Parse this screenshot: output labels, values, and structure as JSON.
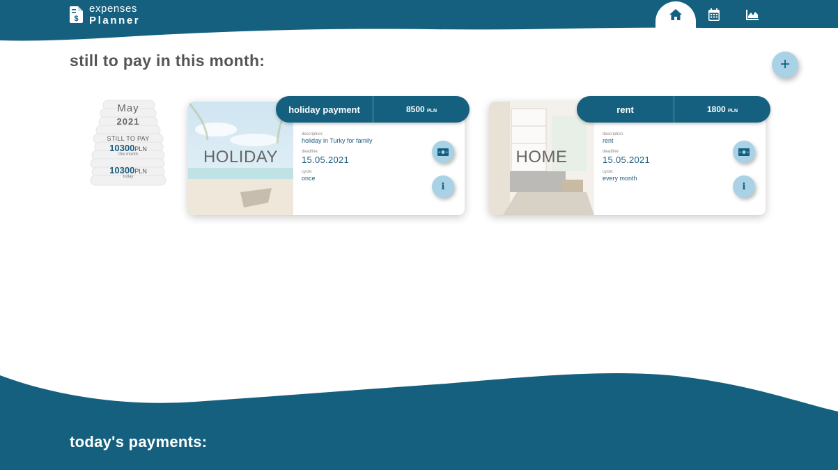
{
  "app": {
    "logo_line1": "expenses",
    "logo_line2": "Planner",
    "logo_icon": "invoice-dollar-icon"
  },
  "colors": {
    "brand": "#15607f",
    "button_bg": "#a9d2e6",
    "text": "#555555"
  },
  "nav": {
    "items": [
      {
        "icon": "home-icon",
        "active": true
      },
      {
        "icon": "calendar-icon",
        "active": false
      },
      {
        "icon": "chart-icon",
        "active": false
      }
    ]
  },
  "main": {
    "heading": "still to pay in this month:",
    "add_button_label": "+"
  },
  "summary": {
    "month": "May",
    "year": "2021",
    "still_label": "STILL TO PAY",
    "month_amount": "10300",
    "month_unit": "PLN",
    "month_caption": "this month",
    "today_amount": "10300",
    "today_unit": "PLN",
    "today_caption": "today"
  },
  "cards": [
    {
      "image_label": "HOLIDAY",
      "name": "holiday payment",
      "amount": "8500",
      "unit": "PLN",
      "description_label": "description:",
      "description": "holiday in Turky for family",
      "deadline_label": "deadline:",
      "deadline": "15.05.2021",
      "cycle_label": "cycle:",
      "cycle": "once",
      "pay_icon": "money-bill-icon",
      "info_label": "i"
    },
    {
      "image_label": "HOME",
      "name": "rent",
      "amount": "1800",
      "unit": "PLN",
      "description_label": "description:",
      "description": "rent",
      "deadline_label": "deadline:",
      "deadline": "15.05.2021",
      "cycle_label": "cycle:",
      "cycle": "every month",
      "pay_icon": "money-bill-icon",
      "info_label": "i"
    }
  ],
  "bottom": {
    "heading": "today's payments:"
  }
}
